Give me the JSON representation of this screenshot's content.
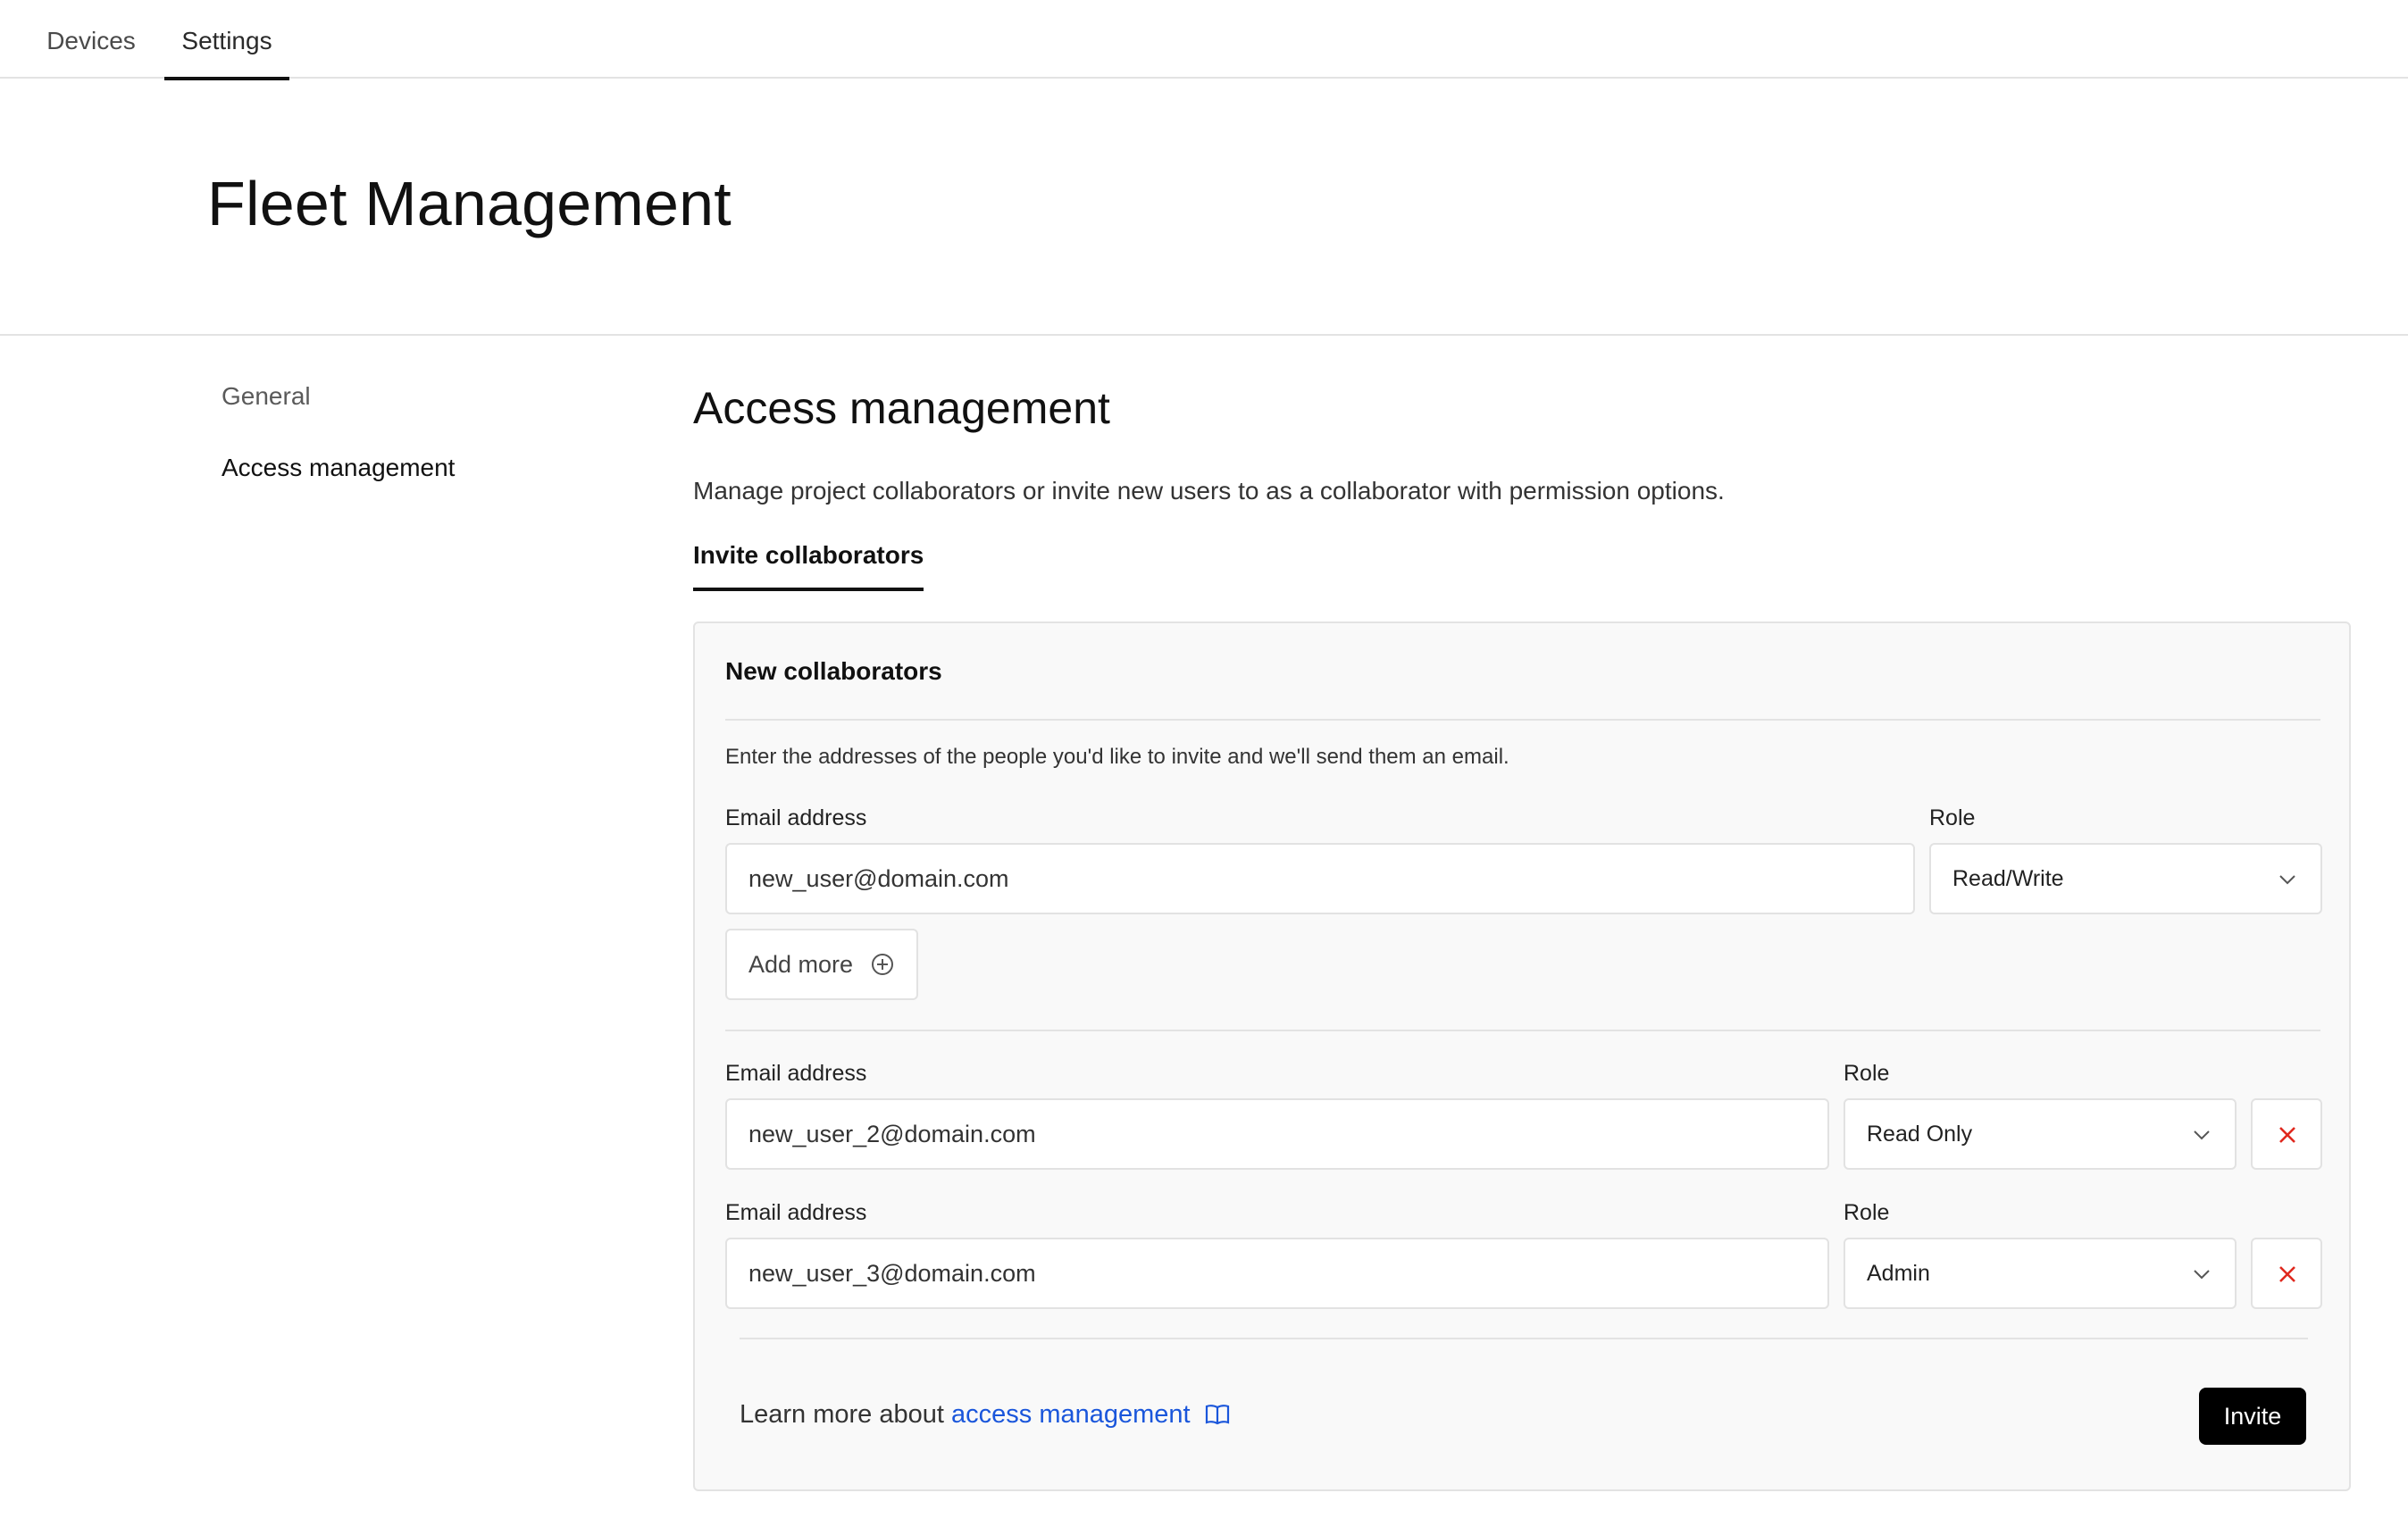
{
  "top_tabs": [
    "Devices",
    "Settings"
  ],
  "active_top_tab": "Settings",
  "page_title": "Fleet Management",
  "sidebar": {
    "items": [
      {
        "label": "General",
        "active": false
      },
      {
        "label": "Access management",
        "active": true
      }
    ]
  },
  "section": {
    "title": "Access management",
    "description": "Manage project collaborators or invite new users to as a collaborator with permission options.",
    "subtab": "Invite collaborators"
  },
  "card": {
    "title": "New collaborators",
    "description": "Enter the addresses of the people you'd like to invite and we'll send them an email.",
    "email_label": "Email address",
    "role_label": "Role",
    "rows": [
      {
        "email": "new_user@domain.com",
        "role": "Read/Write",
        "removable": false
      },
      {
        "email": "new_user_2@domain.com",
        "role": "Read Only",
        "removable": true
      },
      {
        "email": "new_user_3@domain.com",
        "role": "Admin",
        "removable": true
      }
    ],
    "add_more_label": "Add more",
    "footer_prefix": "Learn more about",
    "footer_link": "access management",
    "invite_label": "Invite"
  },
  "colors": {
    "link": "#1a56db",
    "remove_icon": "#e0281e",
    "invite_bg": "#000000"
  }
}
